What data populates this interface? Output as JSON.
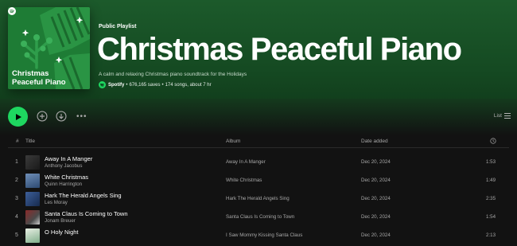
{
  "playlist": {
    "type_label": "Public Playlist",
    "title": "Christmas Peaceful Piano",
    "cover_title": "Christmas\nPeaceful Piano",
    "description": "A calm and relaxing Christmas piano soundtrack for the Holidays",
    "owner": "Spotify",
    "saves": "676,165 saves",
    "songs": "174 songs, about 7 hr",
    "separator": "•"
  },
  "toolbar": {
    "view_label": "List"
  },
  "table": {
    "headers": {
      "num": "#",
      "title": "Title",
      "album": "Album",
      "date": "Date added"
    },
    "rows": [
      {
        "idx": "1",
        "title": "Away In A Manger",
        "artist": "Anthony Jacobus",
        "album": "Away In A Manger",
        "date": "Dec 20, 2024",
        "duration": "1:53"
      },
      {
        "idx": "2",
        "title": "White Christmas",
        "artist": "Quinn Harrington",
        "album": "White Christmas",
        "date": "Dec 20, 2024",
        "duration": "1:49"
      },
      {
        "idx": "3",
        "title": "Hark The Herald Angels Sing",
        "artist": "Les Moray",
        "album": "Hark The Herald Angels Sing",
        "date": "Dec 20, 2024",
        "duration": "2:35"
      },
      {
        "idx": "4",
        "title": "Santa Claus Is Coming to Town",
        "artist": "Jonam Breuer",
        "album": "Santa Claus Is Coming to Town",
        "date": "Dec 20, 2024",
        "duration": "1:54"
      },
      {
        "idx": "5",
        "title": "O Holy Night",
        "artist": "",
        "album": "I Saw Mommy Kissing Santa Claus",
        "date": "Dec 20, 2024",
        "duration": "2:13"
      }
    ]
  },
  "colors": {
    "accent": "#1ed760",
    "header_green": "#1c5a2b",
    "background": "#121212"
  },
  "icons": {
    "play": "play-icon",
    "add": "add-circle-icon",
    "download": "download-circle-icon",
    "more": "more-options-icon",
    "list": "list-view-icon",
    "clock": "clock-icon",
    "spotify": "spotify-logo-icon"
  }
}
